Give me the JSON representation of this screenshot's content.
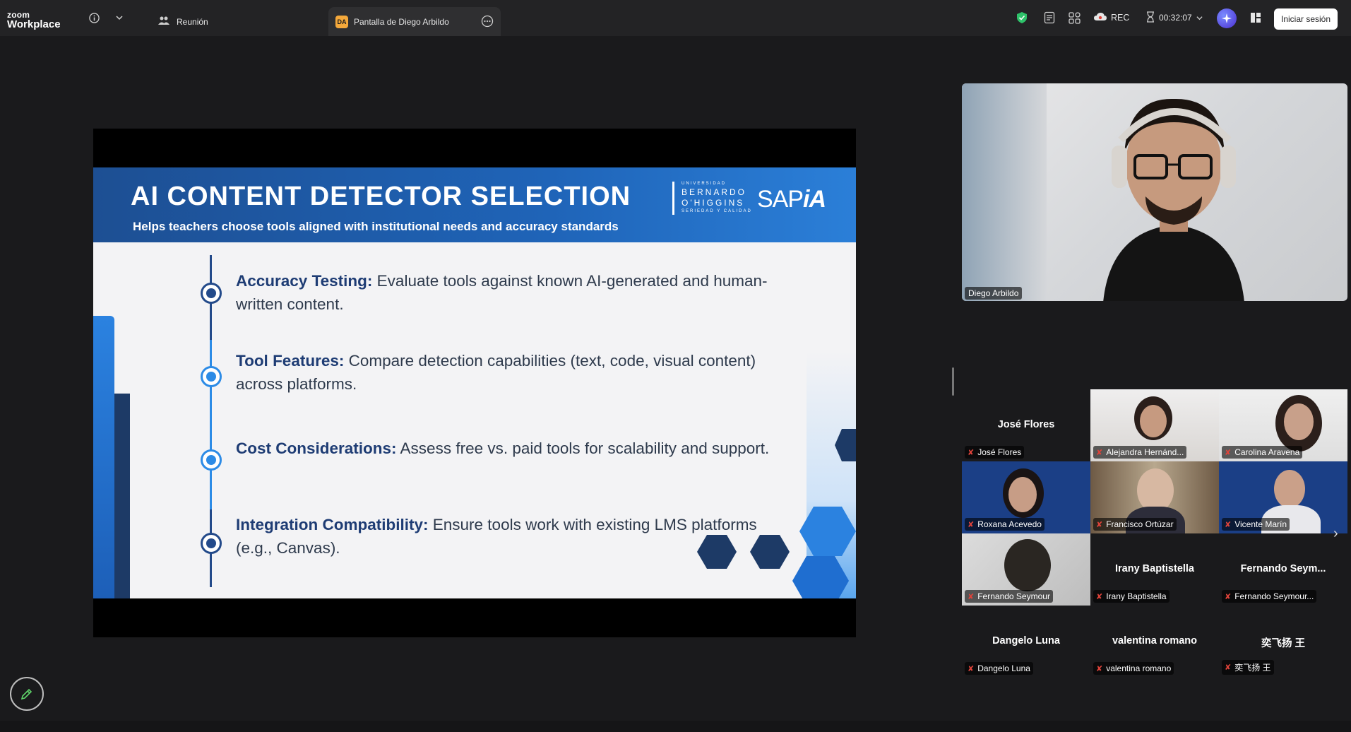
{
  "app": {
    "brand_small": "zoom",
    "brand_name": "Workplace",
    "tabs": [
      {
        "label": "Reunión",
        "icon": "people-icon"
      },
      {
        "label": "Pantalla de Diego Arbildo",
        "badge": "DA",
        "icon": "more-icon"
      }
    ],
    "recording_label": "REC",
    "timer": "00:32:07",
    "signin_label": "Iniciar sesión"
  },
  "slide": {
    "title": "AI CONTENT DETECTOR SELECTION",
    "subtitle": "Helps teachers choose tools aligned with institutional needs and accuracy standards",
    "logo_university": [
      "UNIVERSIDAD",
      "BERNARDO",
      "O'HIGGINS",
      "SERIEDAD Y CALIDAD"
    ],
    "logo_sap": "SAP",
    "logo_sap_ia": "iA",
    "items": [
      {
        "heading": "Accuracy Testing:",
        "text": "Evaluate tools against known AI-generated and human-written content."
      },
      {
        "heading": "Tool Features:",
        "text": "Compare detection capabilities (text, code, visual content) across platforms."
      },
      {
        "heading": "Cost Considerations:",
        "text": "Assess free vs. paid tools for scalability and support."
      },
      {
        "heading": "Integration Compatibility:",
        "text": "Ensure tools work with existing LMS platforms (e.g., Canvas)."
      }
    ]
  },
  "speaker": {
    "name": "Diego Arbildo"
  },
  "participants": [
    {
      "display": "José Flores",
      "tag": "José Flores",
      "video": false
    },
    {
      "display": "",
      "tag": "Alejandra Hernánd...",
      "video": true
    },
    {
      "display": "",
      "tag": "Carolina Aravena",
      "video": true
    },
    {
      "display": "",
      "tag": "Roxana Acevedo",
      "video": true
    },
    {
      "display": "",
      "tag": "Francisco Ortúzar",
      "video": true
    },
    {
      "display": "",
      "tag": "Vicente Marín",
      "video": true
    },
    {
      "display": "",
      "tag": "Fernando Seymour",
      "video": true
    },
    {
      "display": "Irany Baptistella",
      "tag": "Irany Baptistella",
      "video": false
    },
    {
      "display": "Fernando  Seym...",
      "tag": "Fernando Seymour...",
      "video": false
    },
    {
      "display": "Dangelo Luna",
      "tag": "Dangelo Luna",
      "video": false
    },
    {
      "display": "valentina romano",
      "tag": "valentina romano",
      "video": false
    },
    {
      "display": "奕飞扬 王",
      "tag": "奕飞扬 王",
      "video": false
    }
  ],
  "colors": {
    "accent": "#2b82e0",
    "navy": "#1e3c74",
    "mute": "#e0433a",
    "shield": "#2ec26a"
  }
}
